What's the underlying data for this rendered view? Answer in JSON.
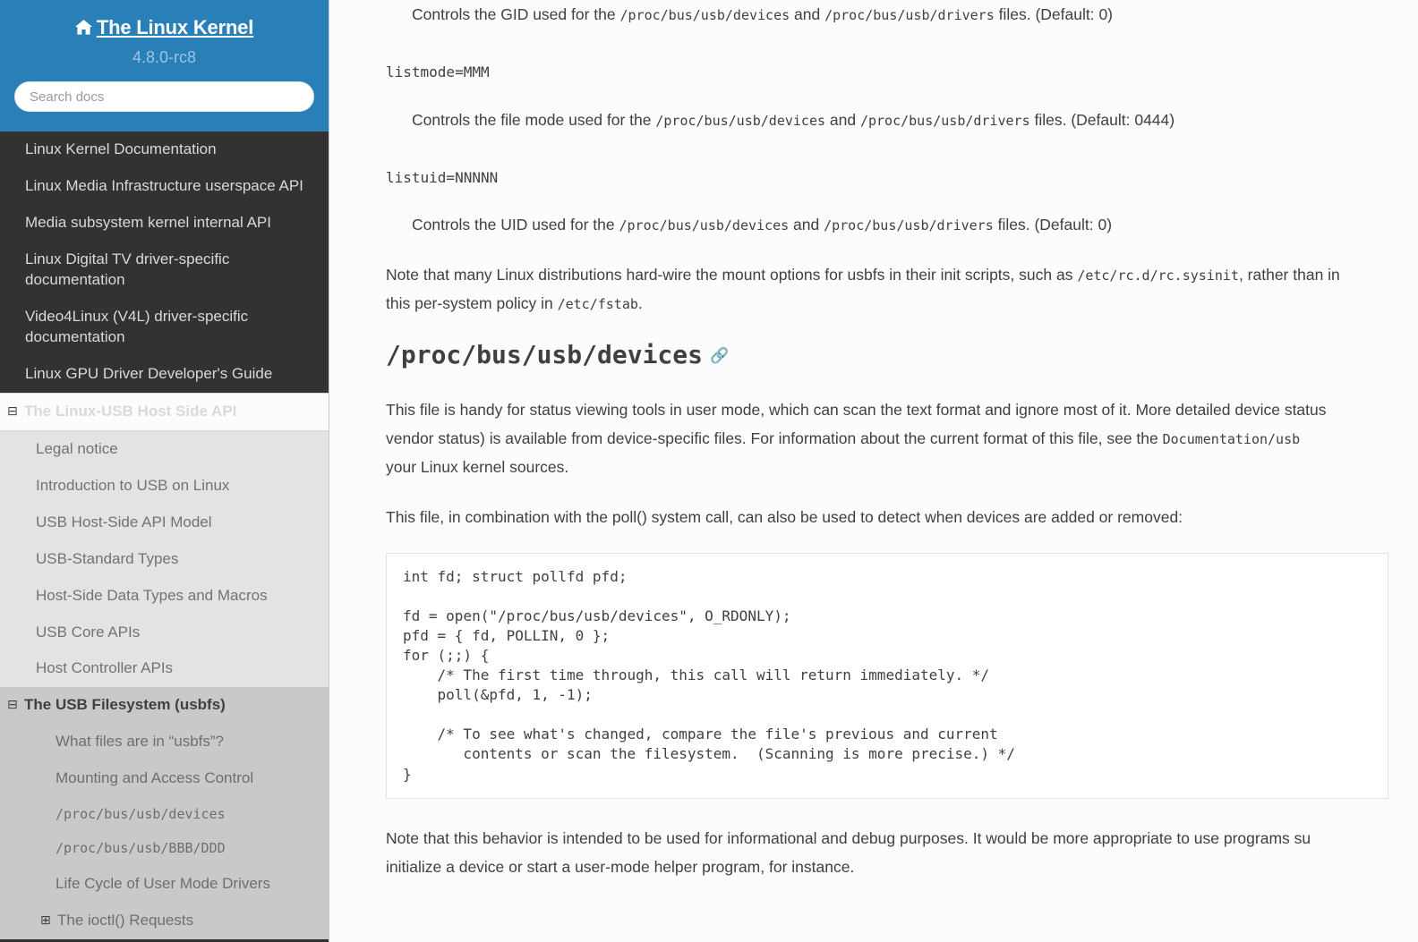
{
  "sidebar": {
    "brand": "The Linux Kernel",
    "home_icon": "home-icon",
    "version": "4.8.0-rc8",
    "search": {
      "placeholder": "Search docs",
      "value": ""
    },
    "top_items": [
      "Linux Kernel Documentation",
      "Linux Media Infrastructure userspace API",
      "Media subsystem kernel internal API",
      "Linux Digital TV driver-specific documentation",
      "Video4Linux (V4L) driver-specific documentation",
      "Linux GPU Driver Developer's Guide"
    ],
    "current_section": {
      "toggle": "⊟",
      "title": "The Linux-USB Host Side API",
      "items": [
        "Legal notice",
        "Introduction to USB on Linux",
        "USB Host-Side API Model",
        "USB-Standard Types",
        "Host-Side Data Types and Macros",
        "USB Core APIs",
        "Host Controller APIs"
      ],
      "current_subsection": {
        "toggle": "⊟",
        "title": "The USB Filesystem (usbfs)",
        "items": [
          {
            "label": "What files are in “usbfs”?",
            "mono": false,
            "toggle": ""
          },
          {
            "label": "Mounting and Access Control",
            "mono": false,
            "toggle": ""
          },
          {
            "label": "/proc/bus/usb/devices",
            "mono": true,
            "toggle": ""
          },
          {
            "label": "/proc/bus/usb/BBB/DDD",
            "mono": true,
            "toggle": ""
          },
          {
            "label": "Life Cycle of User Mode Drivers",
            "mono": false,
            "toggle": ""
          },
          {
            "label": "The ioctl() Requests",
            "mono": false,
            "toggle": "⊞"
          }
        ]
      }
    }
  },
  "content": {
    "defs": [
      {
        "term": "",
        "desc_prefix": "Controls the GID used for the ",
        "code1": "/proc/bus/usb/devices",
        "desc_mid": " and ",
        "code2": "/proc/bus/usb/drivers",
        "desc_suffix": " files. (Default: 0)"
      },
      {
        "term": "listmode=MMM",
        "desc_prefix": "Controls the file mode used for the ",
        "code1": "/proc/bus/usb/devices",
        "desc_mid": " and ",
        "code2": "/proc/bus/usb/drivers",
        "desc_suffix": " files. (Default: 0444)"
      },
      {
        "term": "listuid=NNNNN",
        "desc_prefix": "Controls the UID used for the ",
        "code1": "/proc/bus/usb/devices",
        "desc_mid": " and ",
        "code2": "/proc/bus/usb/drivers",
        "desc_suffix": " files. (Default: 0)"
      }
    ],
    "note_mount": {
      "line1_a": "Note that many Linux distributions hard-wire the mount options for usbfs in their init scripts, such as ",
      "line1_code": "/etc/rc.d/rc.sysinit",
      "line1_b": ", rather than in ",
      "line2_a": "this per-system policy in ",
      "line2_code": "/etc/fstab",
      "line2_b": "."
    },
    "heading": {
      "title": "/proc/bus/usb/devices",
      "permalink": "¶",
      "permalink_icon": "link-icon"
    },
    "para_handy": {
      "line1": "This file is handy for status viewing tools in user mode, which can scan the text format and ignore most of it. More detailed device status",
      "line2_a": "vendor status) is available from device-specific files. For information about the current format of this file, see the ",
      "line2_code": "Documentation/usb",
      "line3": "your Linux kernel sources."
    },
    "para_poll": "This file, in combination with the poll() system call, can also be used to detect when devices are added or removed:",
    "code_block": "int fd; struct pollfd pfd;\n\nfd = open(\"/proc/bus/usb/devices\", O_RDONLY);\npfd = { fd, POLLIN, 0 };\nfor (;;) {\n    /* The first time through, this call will return immediately. */\n    poll(&pfd, 1, -1);\n\n    /* To see what's changed, compare the file's previous and current\n       contents or scan the filesystem.  (Scanning is more precise.) */\n}",
    "para_behavior": {
      "line1": "Note that this behavior is intended to be used for informational and debug purposes. It would be more appropriate to use programs su",
      "line2": "initialize a device or start a user-mode helper program, for instance."
    }
  },
  "colors": {
    "brand_blue": "#2980b9",
    "sidebar_dark": "#343131",
    "nav_level2_bg": "#e3e3e3",
    "nav_level3_bg": "#c9c9c9",
    "text": "#404040",
    "link": "#2980b9"
  }
}
